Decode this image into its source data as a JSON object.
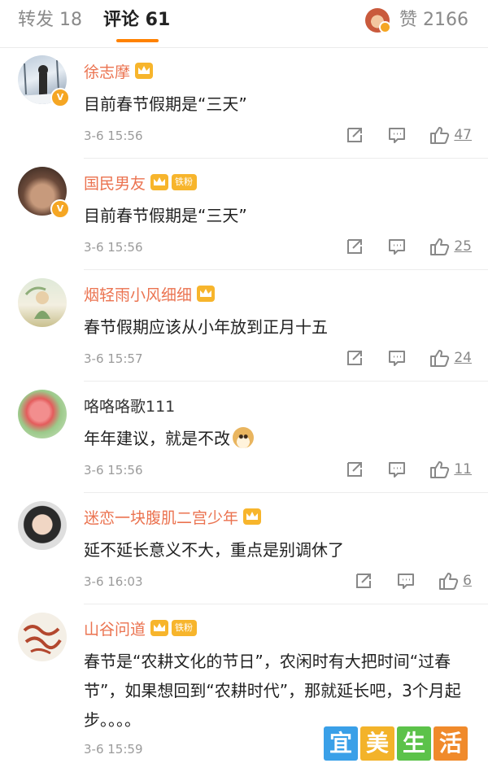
{
  "tabs": {
    "repost_label": "转发 18",
    "comment_label": "评论 61",
    "like_label": "赞 2166"
  },
  "comments": [
    {
      "name": "徐志摩",
      "text": "目前春节假期是“三天”",
      "time": "3-6 15:56",
      "likes": "47",
      "fan_badge": ""
    },
    {
      "name": "国民男友",
      "text": "目前春节假期是“三天”",
      "time": "3-6 15:56",
      "likes": "25",
      "fan_badge": "铁粉"
    },
    {
      "name": "烟轻雨小风细细",
      "text": "春节假期应该从小年放到正月十五",
      "time": "3-6 15:57",
      "likes": "24",
      "fan_badge": ""
    },
    {
      "name": "咯咯咯歌111",
      "text": "年年建议，就是不改",
      "time": "3-6 15:56",
      "likes": "11",
      "fan_badge": ""
    },
    {
      "name": "迷恋一块腹肌二宫少年",
      "text": "延不延长意义不大，重点是别调休了",
      "time": "3-6 16:03",
      "likes": "6",
      "fan_badge": ""
    },
    {
      "name": "山谷问道",
      "text": "春节是“农耕文化的节日”，农闲时有大把时间“过春节”，如果想回到“农耕时代”，那就延长吧，3个月起步。。。。",
      "time": "3-6 15:59",
      "likes": "",
      "fan_badge": "铁粉"
    }
  ],
  "icons": {
    "repost": "repost-icon",
    "reply": "comment-icon",
    "like": "thumbs-up-icon",
    "verified": "verified-badge-icon",
    "vip": "crown-icon",
    "emoji": "doge-emoji-icon"
  },
  "watermark": {
    "chars": [
      "宜",
      "美",
      "生",
      "活"
    ],
    "colors": [
      "#3aa0e8",
      "#f3b32a",
      "#5cc24a",
      "#f08a2b"
    ]
  },
  "colors": {
    "accent": "#ff8200",
    "username": "#eb7350",
    "vip_gold": "#f7b52c"
  }
}
